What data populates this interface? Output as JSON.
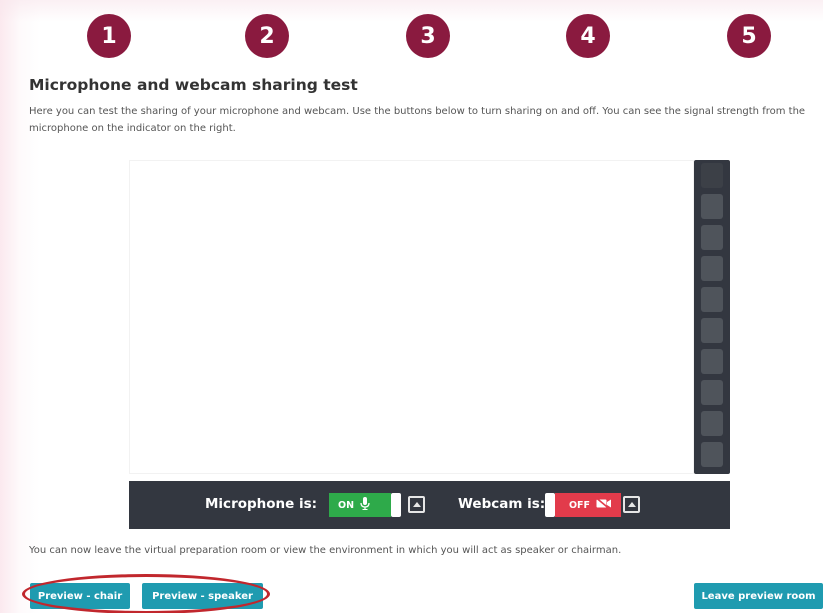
{
  "steps": [
    "1",
    "2",
    "3",
    "4",
    "5"
  ],
  "page": {
    "title": "Microphone and webcam sharing test",
    "description": "Here you can test the sharing of your microphone and webcam. Use the buttons below to turn sharing on and off. You can see the signal strength from the microphone on the indicator on the right."
  },
  "signal_meter": {
    "cells": 10,
    "level": 0
  },
  "controls": {
    "microphone_label": "Microphone is:",
    "microphone_state": "ON",
    "microphone_icon": "microphone-icon",
    "webcam_label": "Webcam is:",
    "webcam_state": "OFF",
    "webcam_icon": "camera-off-icon",
    "on_color": "#2eaa4a",
    "off_color": "#e23b4b"
  },
  "note": "You can now leave the virtual preparation room or view the environment in which you will act as speaker or chairman.",
  "buttons": {
    "preview_chair": "Preview - chair",
    "preview_speaker": "Preview - speaker",
    "leave_preview": "Leave preview room"
  },
  "colors": {
    "step_circle": "#8a1a3f",
    "button": "#1f9bb0",
    "control_bar": "#333740",
    "highlight_oval": "#c1272d"
  }
}
